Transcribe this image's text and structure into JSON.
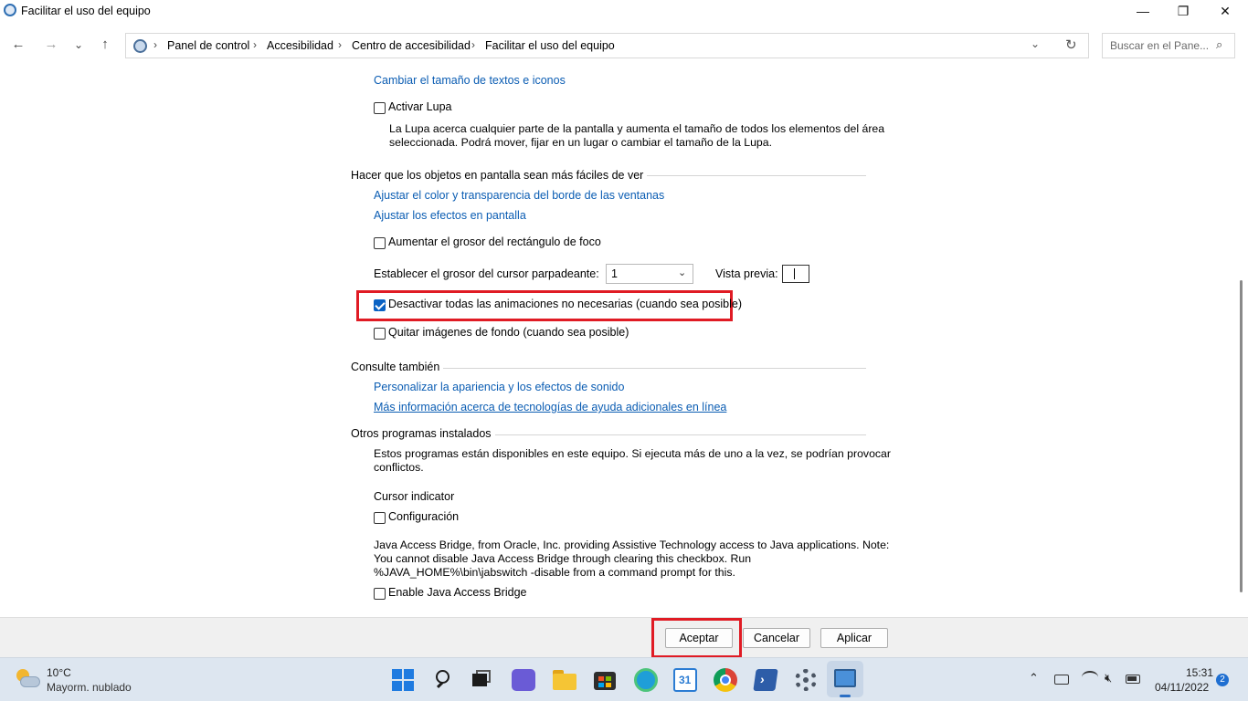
{
  "window": {
    "title": "Facilitar el uso del equipo",
    "minimize": "—",
    "restore": "❐",
    "close": "✕"
  },
  "nav": {
    "back": "←",
    "forward": "→",
    "recent": "⌄",
    "up": "↑",
    "breadcrumb": [
      "Panel de control",
      "Accesibilidad",
      "Centro de accesibilidad",
      "Facilitar el uso del equipo"
    ],
    "separator": "›",
    "dropdown": "⌄",
    "refresh": "↻",
    "search_placeholder": "Buscar en el Pane...",
    "search_icon": "⌕"
  },
  "content": {
    "link_text_size": "Cambiar el tamaño de textos e iconos",
    "magnifier_label": "Activar Lupa",
    "magnifier_checked": false,
    "magnifier_desc_1": "La Lupa acerca cualquier parte de la pantalla y aumenta el tamaño de todos los elementos del área",
    "magnifier_desc_2": "seleccionada. Podrá mover, fijar en un lugar o cambiar el tamaño de la Lupa.",
    "section_visibility": "Hacer que los objetos en pantalla sean más fáciles de ver",
    "link_window_color": "Ajustar el color y transparencia del borde de las ventanas",
    "link_effects": "Ajustar los efectos en pantalla",
    "focus_rect_label": "Aumentar el grosor del rectángulo de foco",
    "focus_rect_checked": false,
    "cursor_thickness_label": "Establecer el grosor del cursor parpadeante:",
    "cursor_thickness_value": "1",
    "combo_arrow": "⌄",
    "preview_label": "Vista previa:",
    "animations_label": "Desactivar todas las animaciones no necesarias (cuando sea posible)",
    "animations_checked": true,
    "background_label": "Quitar imágenes de fondo (cuando sea posible)",
    "background_checked": false,
    "section_see_also": "Consulte también",
    "link_personalize": "Personalizar la apariencia y los efectos de sonido",
    "link_more_info": "Más información acerca de tecnologías de ayuda adicionales en línea",
    "section_other_programs": "Otros programas instalados",
    "programs_desc_1": "Estos programas están disponibles en este equipo. Si ejecuta más de uno a la vez, se podrían provocar",
    "programs_desc_2": "conflictos.",
    "cursor_indicator_title": "Cursor indicator",
    "configuration_label": "Configuración",
    "configuration_checked": false,
    "java_desc_1": "Java Access Bridge, from Oracle, Inc. providing Assistive Technology access to Java applications. Note:",
    "java_desc_2": "You cannot disable Java Access Bridge through clearing this checkbox. Run",
    "java_desc_3": "%JAVA_HOME%\\bin\\jabswitch -disable from a command prompt for this.",
    "java_label": "Enable Java Access Bridge",
    "java_checked": false
  },
  "buttons": {
    "ok": "Aceptar",
    "cancel": "Cancelar",
    "apply": "Aplicar"
  },
  "taskbar": {
    "weather_temp": "10°C",
    "weather_desc": "Mayorm. nublado",
    "calendar_day": "31",
    "tray_chevron": "⌃",
    "time": "15:31",
    "date": "04/11/2022",
    "notification_count": "2"
  },
  "colors": {
    "link": "#0b5db3",
    "highlight_box": "#e01b24",
    "checkbox_checked": "#0a62c4",
    "taskbar": "#dde6f0"
  }
}
